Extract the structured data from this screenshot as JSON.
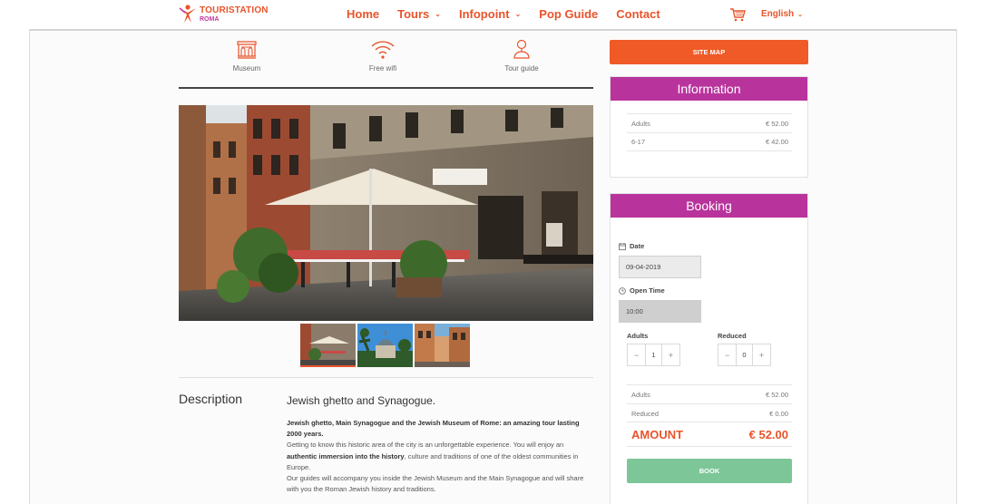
{
  "header": {
    "logo_main": "TOURISTATION",
    "logo_sub": "ROMA",
    "nav": [
      {
        "label": "Home",
        "has_dropdown": false
      },
      {
        "label": "Tours",
        "has_dropdown": true
      },
      {
        "label": "Infopoint",
        "has_dropdown": true
      },
      {
        "label": "Pop Guide",
        "has_dropdown": false
      },
      {
        "label": "Contact",
        "has_dropdown": false
      }
    ],
    "language": "English"
  },
  "features": [
    {
      "label": "Museum",
      "icon": "museum-icon"
    },
    {
      "label": "Free wifi",
      "icon": "wifi-icon"
    },
    {
      "label": "Tour guide",
      "icon": "tour-guide-icon"
    }
  ],
  "gallery": {
    "thumbs": [
      "street-restaurant-photo",
      "synagogue-dome-photo",
      "old-street-photo"
    ],
    "active_index": 0
  },
  "description": {
    "heading": "Description",
    "subtitle": "Jewish ghetto and Synagogue.",
    "intro_bold": "Jewish ghetto, Main Synagogue and the Jewish Museum of Rome: an amazing tour lasting 2000 years.",
    "para1": "Getting to know this historic area of the city is an unforgettable experience. You will enjoy an",
    "para1_bold": "authentic immersion into the history",
    "para1_rest": ", culture and traditions of one of the oldest communities in Europe.",
    "para2": "Our guides will accompany you inside the Jewish Museum and the Main Synagogue and will share with you the Roman Jewish history and traditions."
  },
  "sidebar": {
    "sitemap_label": "SITE MAP",
    "information": {
      "title": "Information",
      "rows": [
        {
          "label": "Adults",
          "price": "€ 52.00"
        },
        {
          "label": "6-17",
          "price": "€ 42.00"
        }
      ]
    },
    "booking": {
      "title": "Booking",
      "date_label": "Date",
      "date_value": "09-04-2019",
      "time_label": "Open Time",
      "time_value": "10:00",
      "adults_label": "Adults",
      "adults_qty": "1",
      "reduced_label": "Reduced",
      "reduced_qty": "0",
      "minus": "−",
      "plus": "+",
      "summary": [
        {
          "label": "Adults",
          "price": "€ 52.00"
        },
        {
          "label": "Reduced",
          "price": "€ 0.00"
        }
      ],
      "amount_label": "AMOUNT",
      "amount_value": "€ 52.00",
      "book_label": "BOOK"
    }
  },
  "colors": {
    "brand_orange": "#e8542b",
    "brand_purple": "#b8349c",
    "book_green": "#7cc698"
  }
}
